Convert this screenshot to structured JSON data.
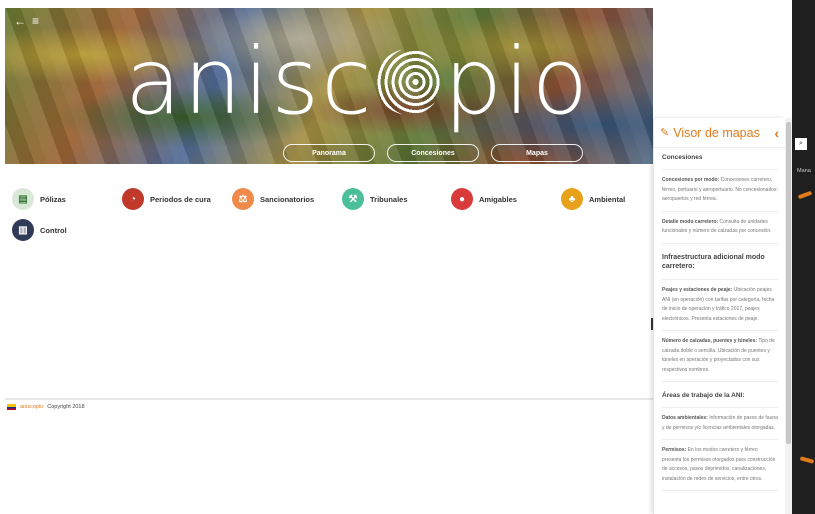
{
  "hero": {
    "back_icon": "back-arrow-icon",
    "menu_icon": "hamburger-menu-icon",
    "logo_text_a": "ani",
    "logo_text_b": "sc",
    "logo_text_c": "pio",
    "pills": [
      "Panorama",
      "Concesiones",
      "Mapas"
    ]
  },
  "categories": [
    {
      "label": "Pólizas",
      "color": "#d9e8d7",
      "icon": "policy-icon"
    },
    {
      "label": "Periodos de cura",
      "color": "#c0392b",
      "icon": "clock-icon"
    },
    {
      "label": "Sancionatorios",
      "color": "#f08a4b",
      "icon": "scales-icon"
    },
    {
      "label": "Tribunales",
      "color": "#4bbf9a",
      "icon": "gavel-icon"
    },
    {
      "label": "Amigables",
      "color": "#d93a3a",
      "icon": "handshake-icon"
    },
    {
      "label": "Ambiental",
      "color": "#e8a11a",
      "icon": "tree-icon"
    },
    {
      "label": "Control",
      "color": "#2f3b57",
      "icon": "control-icon"
    }
  ],
  "footer": {
    "brand": "aniscopio",
    "copyright": "Copyright 2018"
  },
  "panel": {
    "title": "Visor de mapas",
    "pin_icon": "pin-icon",
    "collapse_icon": "chevron-left-icon",
    "section1": "Concesiones",
    "items1": [
      {
        "bold": "Concesiones por modo:",
        "text": " Concesiones carretero, férreo, portuario y aeroportuario. No concesionados: aeropuertos y red férrea."
      },
      {
        "bold": "Detalle modo carretero:",
        "text": " Consulta de unidades funcionales y número de calzadas por concesión."
      }
    ],
    "section2": "Infraestructura adicional modo carretero:",
    "items2": [
      {
        "bold": "Peajes y estaciones de peaje:",
        "text": " Ubicación peajes ANI (en operación) con tarifas por categoría, fecha de inicio de operación y tráfico 2017, peajes electrónicos. Presenta estaciones de peaje."
      },
      {
        "bold": "Número de calzadas, puentes y túneles:",
        "text": " Tipo de calzada doble o sencilla. Ubicación de puentes y túneles en operación y proyectados con sus respectivos nombres."
      }
    ],
    "section3": "Áreas de trabajo de la ANI:",
    "items3": [
      {
        "bold": "Datos ambientales:",
        "text": " Información de pasos de fauna y de permisos y/o licencias ambientales otorgadas."
      },
      {
        "bold": "Permisos:",
        "text": " En los modos carretero y férreo presenta los permisos otorgados para construcción de accesos, pasos deprimidos, canalizaciones, instalación de redes de servicios, entre otros."
      }
    ]
  },
  "side": {
    "search_icon": "search-icon",
    "label": "Mana"
  }
}
